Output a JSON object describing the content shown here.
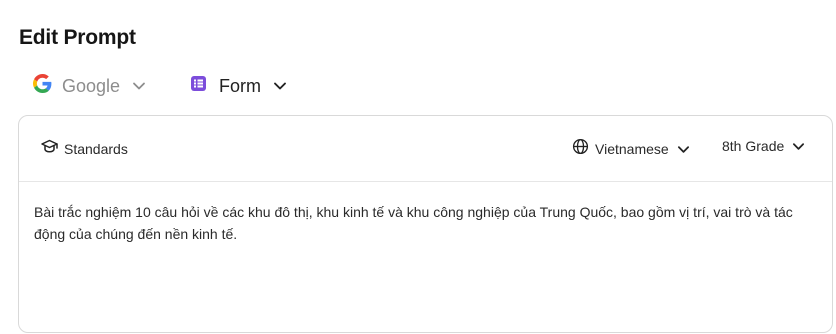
{
  "page": {
    "title": "Edit Prompt"
  },
  "source_selector": {
    "label": "Google",
    "icon": "google-icon"
  },
  "type_selector": {
    "label": "Form",
    "icon": "form-list-icon",
    "accent": "#7c4ddb"
  },
  "card": {
    "standards_label": "Standards",
    "language": "Vietnamese",
    "grade": "8th Grade",
    "prompt": "Bài trắc nghiệm 10 câu hỏi về các khu đô thị, khu kinh tế và khu công nghiệp của Trung Quốc, bao gồm vị trí, vai trò và tác động của chúng đến nền kinh tế."
  }
}
